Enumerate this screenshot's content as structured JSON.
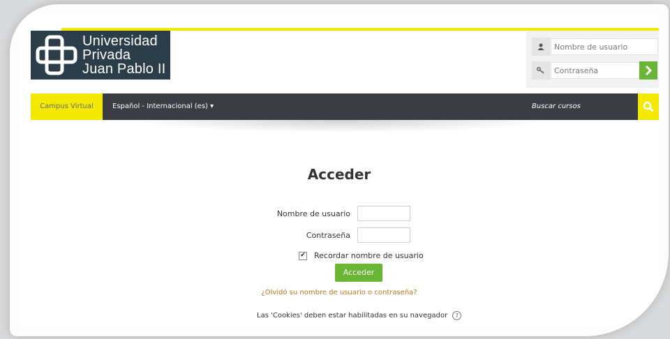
{
  "logo": {
    "line1": "Universidad",
    "line2": "Privada",
    "line3": "Juan Pablo II",
    "colors": {
      "background": "#2c3d4a",
      "text": "#ffffff"
    }
  },
  "quick_login": {
    "username_placeholder": "Nombre de usuario",
    "password_placeholder": "Contraseña",
    "user_icon": "user-icon",
    "key_icon": "key-icon",
    "go_icon": "chevron-right-icon"
  },
  "navbar": {
    "home_label": "Campus Virtual",
    "language_label": "Español - Internacional (es) ▾",
    "search_label": "Buscar cursos",
    "search_icon": "search-icon"
  },
  "login_form": {
    "title": "Acceder",
    "username_label": "Nombre de usuario",
    "password_label": "Contraseña",
    "remember_label": "Recordar nombre de usuario",
    "remember_checked": true,
    "submit_label": "Acceder",
    "forgot_link": "¿Olvidó su nombre de usuario o contraseña?",
    "cookies_notice": "Las 'Cookies' deben estar habilitadas en su navegador",
    "help_icon": "help-icon"
  },
  "colors": {
    "accent_yellow": "#f4e900",
    "navbar_dark": "#3a3d42",
    "button_green": "#6ab535",
    "link_orange": "#b97a1b"
  }
}
